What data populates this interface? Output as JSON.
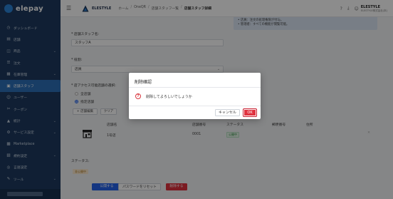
{
  "app": {
    "brand": "elepay",
    "name": "ELESTYLE"
  },
  "sidebar": {
    "items": [
      {
        "label": "ダッシュボード",
        "icon": "dashboard-icon",
        "glyph": "◷",
        "chevron": false,
        "active": false
      },
      {
        "label": "店舗",
        "icon": "store-icon",
        "glyph": "▤",
        "chevron": false,
        "active": false
      },
      {
        "label": "商品",
        "icon": "product-icon",
        "glyph": "◫",
        "chevron": true,
        "active": false
      },
      {
        "label": "注文",
        "icon": "order-icon",
        "glyph": "☰",
        "chevron": false,
        "active": false
      },
      {
        "label": "在庫管理",
        "icon": "inventory-icon",
        "glyph": "▦",
        "chevron": true,
        "active": false
      },
      {
        "label": "店舗スタッフ",
        "icon": "staff-icon",
        "glyph": "▣",
        "chevron": false,
        "active": true
      },
      {
        "label": "ユーザー",
        "icon": "user-icon",
        "glyph": "☺",
        "chevron": false,
        "active": false
      },
      {
        "label": "クーポン",
        "icon": "coupon-icon",
        "glyph": "✂",
        "chevron": false,
        "active": false
      },
      {
        "label": "統計",
        "icon": "stats-icon",
        "glyph": "▲",
        "chevron": true,
        "active": false
      },
      {
        "label": "サービス設定",
        "icon": "service-icon",
        "glyph": "⚙",
        "chevron": true,
        "active": false
      },
      {
        "label": "Marketplace",
        "icon": "marketplace-icon",
        "glyph": "▩",
        "chevron": false,
        "active": false
      },
      {
        "label": "規約設定",
        "icon": "terms-icon",
        "glyph": "▧",
        "chevron": true,
        "active": false
      },
      {
        "label": "言語設定",
        "icon": "language-icon",
        "glyph": "◎",
        "chevron": false,
        "active": false
      },
      {
        "label": "ツール",
        "icon": "tool-icon",
        "glyph": "✎",
        "chevron": true,
        "active": false
      }
    ]
  },
  "header": {
    "breadcrumb": [
      "ホーム",
      "OneQR",
      "店舗スタッフ一覧",
      "店舗スタッフ詳細"
    ],
    "user_name": "ELESTYLE",
    "user_sub": "ELESTYLE株式会社(本)"
  },
  "notice": {
    "lines": [
      "• 店員：注文の処理権限が付与。",
      "• 管理者：すべての機能が閲覧可能。"
    ]
  },
  "form": {
    "name_label": "* 店舗スタッフ名:",
    "name_value": "スタッフA",
    "role_label": "* 役割:",
    "role_value": "店員",
    "access_label": "* 店アクセス可能店舗の選択:",
    "radio_all": "全店舗",
    "radio_specified": "指定店舗",
    "add_store_button": "+ 店舗編集",
    "clear_button": "クリア"
  },
  "table": {
    "headers": [
      "店舗名",
      "店舗番号",
      "ステータス",
      "郵便番号",
      "住所"
    ],
    "rows": [
      {
        "name": "1号店",
        "number": "0001",
        "status": "公開中",
        "zip": "",
        "address": ""
      }
    ]
  },
  "status_section": {
    "label": "ステータス:",
    "value": "非公開中"
  },
  "footer": {
    "publish": "公開する",
    "reset_password": "パスワードをリセット",
    "delete": "削除する"
  },
  "dialog": {
    "title": "削除確認",
    "message": "削除してよろしいでしょうか",
    "cancel": "キャンセル",
    "ok": "OK"
  },
  "colors": {
    "sidebar": "#1e3a5f",
    "active": "#2d6fb8",
    "primary": "#2563eb",
    "danger": "#e0323f"
  }
}
